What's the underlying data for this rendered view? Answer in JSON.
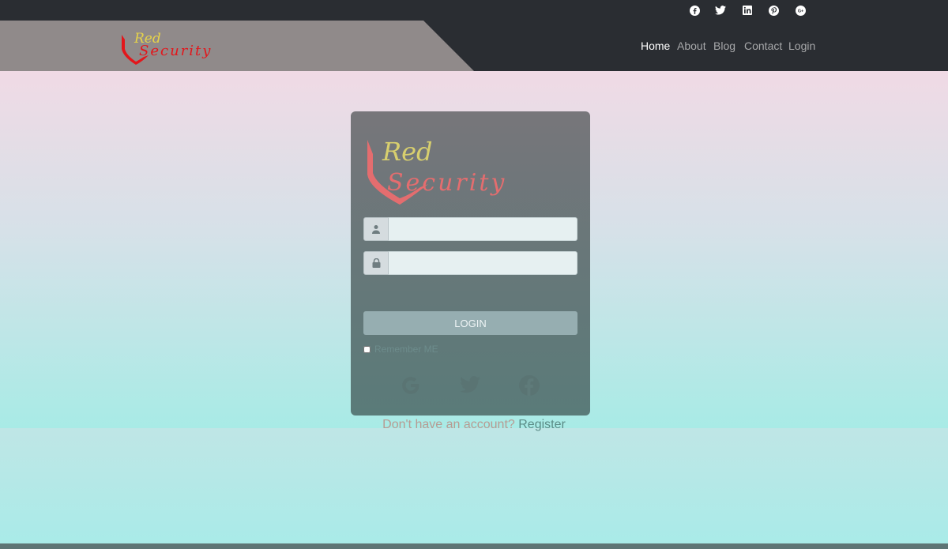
{
  "brand": {
    "logo_name": "Red Security logo",
    "colors": {
      "red": "#e3161b",
      "yellow": "#e5d24a"
    }
  },
  "social_top": [
    {
      "name": "facebook",
      "icon": "facebook-icon"
    },
    {
      "name": "twitter",
      "icon": "twitter-icon"
    },
    {
      "name": "linkedin",
      "icon": "linkedin-icon"
    },
    {
      "name": "pinterest",
      "icon": "pinterest-icon"
    },
    {
      "name": "google-plus",
      "icon": "google-plus-icon"
    }
  ],
  "nav": {
    "home": "Home",
    "about": "About",
    "blog": "Blog",
    "contact": "Contact",
    "login": "Login"
  },
  "login_form": {
    "username_value": "",
    "password_value": "",
    "button_label": "LOGIN",
    "remember_label": "Remember ME",
    "remember_checked": false,
    "social_logins": [
      "google-icon",
      "twitter-icon",
      "facebook-icon"
    ]
  },
  "register": {
    "question": "Don't have an account?",
    "link": "Register"
  }
}
